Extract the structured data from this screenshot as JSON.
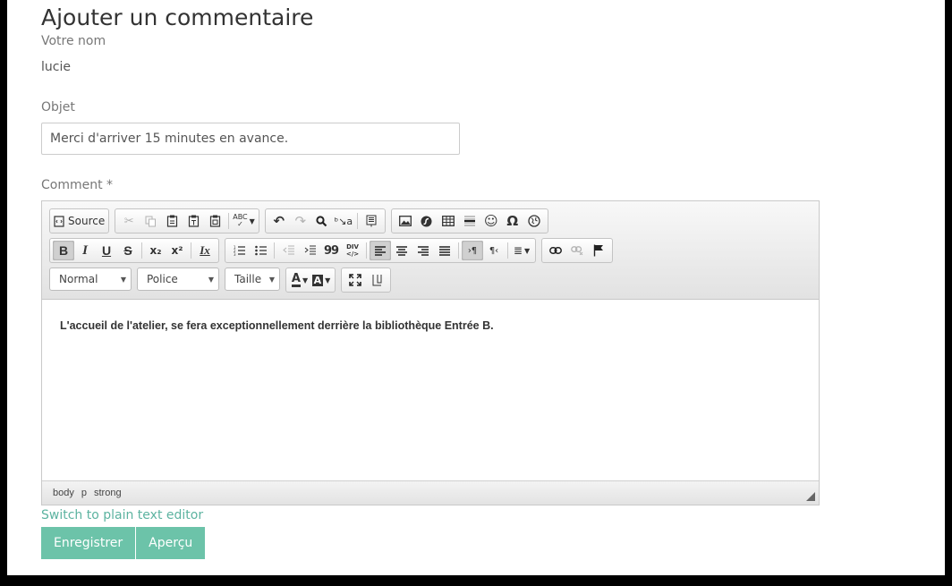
{
  "form": {
    "title": "Ajouter un commentaire",
    "name_label": "Votre nom",
    "name_value": "lucie",
    "subject_label": "Objet",
    "subject_value": "Merci d'arriver 15 minutes en avance.",
    "comment_label": "Comment *"
  },
  "toolbar": {
    "row1": {
      "source_label": "Source",
      "buttons": [
        "cut-icon",
        "copy-icon",
        "paste-icon",
        "paste-text-icon",
        "paste-word-icon",
        "spellcheck-icon",
        "undo-icon",
        "redo-icon",
        "find-icon",
        "replace-icon",
        "select-all-icon",
        "image-icon",
        "flash-icon",
        "table-icon",
        "horizontal-rule-icon",
        "smiley-icon",
        "omega-icon",
        "iframe-icon"
      ],
      "spellcheck_glyph": "ABC",
      "omega_glyph": "Ω"
    },
    "row2": {
      "bold": "B",
      "italic": "I",
      "underline": "U",
      "strike": "S",
      "subscript": "x₂",
      "superscript": "x²",
      "remove_format": "Ix",
      "blockquote": "99",
      "div": "DIV"
    },
    "row3": {
      "format_value": "Normal",
      "font_value": "Police",
      "size_value": "Taille",
      "text_color": "A",
      "bg_color": "A"
    }
  },
  "editor": {
    "content": "L'accueil de l'atelier, se fera exceptionnellement derrière la bibliothèque Entrée B.",
    "path": [
      "body",
      "p",
      "strong"
    ]
  },
  "links": {
    "switch_editor": "Switch to plain text editor"
  },
  "actions": {
    "save": "Enregistrer",
    "preview": "Aperçu"
  },
  "colors": {
    "accent": "#6cc3a9",
    "link": "#5cb3a0"
  }
}
